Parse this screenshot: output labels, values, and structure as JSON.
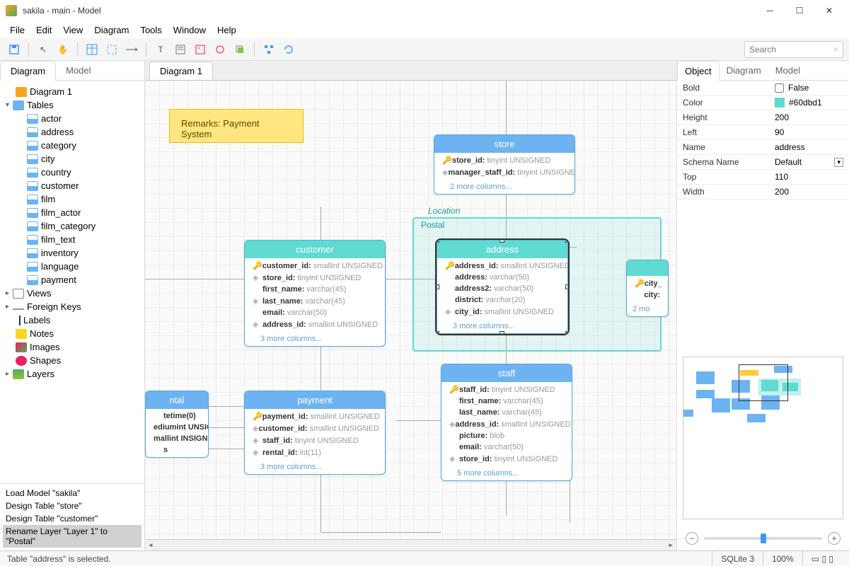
{
  "window": {
    "title": "sakila - main - Model"
  },
  "menu": [
    "File",
    "Edit",
    "View",
    "Diagram",
    "Tools",
    "Window",
    "Help"
  ],
  "search": {
    "placeholder": "Search"
  },
  "left": {
    "tabs": [
      "Diagram",
      "Model"
    ],
    "tree": {
      "diagram": "Diagram 1",
      "tables_label": "Tables",
      "tables": [
        "actor",
        "address",
        "category",
        "city",
        "country",
        "customer",
        "film",
        "film_actor",
        "film_category",
        "film_text",
        "inventory",
        "language",
        "payment"
      ],
      "views": "Views",
      "fkeys": "Foreign Keys",
      "labels": "Labels",
      "notes": "Notes",
      "images": "Images",
      "shapes": "Shapes",
      "layers": "Layers"
    },
    "history": [
      "Load Model \"sakila\"",
      "Design Table \"store\"",
      "Design Table \"customer\"",
      "Rename Layer \"Layer 1\" to \"Postal\""
    ]
  },
  "canvas": {
    "tab": "Diagram 1",
    "note": "Remarks: Payment System",
    "location_label": "Location",
    "postal_label": "Postal",
    "entities": {
      "store": {
        "title": "store",
        "rows": [
          [
            "pk",
            "store_id:",
            "tinyint UNSIGNED"
          ],
          [
            "fk",
            "manager_staff_id:",
            "tinyint UNSIGNED"
          ]
        ],
        "more": "2 more columns..."
      },
      "customer": {
        "title": "customer",
        "rows": [
          [
            "pk",
            "customer_id:",
            "smallint UNSIGNED"
          ],
          [
            "fk",
            "store_id:",
            "tinyint UNSIGNED"
          ],
          [
            "",
            "first_name:",
            "varchar(45)"
          ],
          [
            "fk",
            "last_name:",
            "varchar(45)"
          ],
          [
            "",
            "email:",
            "varchar(50)"
          ],
          [
            "fk",
            "address_id:",
            "smallint UNSIGNED"
          ]
        ],
        "more": "3 more columns..."
      },
      "address": {
        "title": "address",
        "rows": [
          [
            "pk",
            "address_id:",
            "smallint UNSIGNED"
          ],
          [
            "",
            "address:",
            "varchar(50)"
          ],
          [
            "",
            "address2:",
            "varchar(50)"
          ],
          [
            "",
            "district:",
            "varchar(20)"
          ],
          [
            "fk",
            "city_id:",
            "smallint UNSIGNED"
          ]
        ],
        "more": "3 more columns..."
      },
      "city": {
        "title": "",
        "rows": [
          [
            "pk",
            "city_",
            ""
          ],
          [
            "",
            "city:",
            ""
          ]
        ],
        "more": "2 mo"
      },
      "rental": {
        "title": "ntal",
        "rows": [
          [
            "",
            "tetime(0)",
            ""
          ],
          [
            "",
            "ediumint UNSIGN...",
            ""
          ],
          [
            "",
            "mallint INSIGNED",
            ""
          ],
          [
            "",
            "s",
            ""
          ]
        ]
      },
      "payment": {
        "title": "payment",
        "rows": [
          [
            "pk",
            "payment_id:",
            "smallint UNSIGNED"
          ],
          [
            "fk",
            "customer_id:",
            "smallint UNSIGNED"
          ],
          [
            "fk",
            "staff_id:",
            "tinyint UNSIGNED"
          ],
          [
            "fk",
            "rental_id:",
            "int(11)"
          ]
        ],
        "more": "3 more columns..."
      },
      "staff": {
        "title": "staff",
        "rows": [
          [
            "pk",
            "staff_id:",
            "tinyint UNSIGNED"
          ],
          [
            "",
            "first_name:",
            "varchar(45)"
          ],
          [
            "",
            "last_name:",
            "varchar(45)"
          ],
          [
            "fk",
            "address_id:",
            "smallint UNSIGNED"
          ],
          [
            "",
            "picture:",
            "blob"
          ],
          [
            "",
            "email:",
            "varchar(50)"
          ],
          [
            "fk",
            "store_id:",
            "tinyint UNSIGNED"
          ]
        ],
        "more": "5 more columns..."
      }
    }
  },
  "right": {
    "tabs": [
      "Object",
      "Diagram",
      "Model"
    ],
    "props": [
      [
        "Bold",
        "False"
      ],
      [
        "Color",
        "#60dbd1"
      ],
      [
        "Height",
        "200"
      ],
      [
        "Left",
        "90"
      ],
      [
        "Name",
        "address"
      ],
      [
        "Schema Name",
        "Default"
      ],
      [
        "Top",
        "110"
      ],
      [
        "Width",
        "200"
      ]
    ]
  },
  "status": {
    "msg": "Table \"address\" is selected.",
    "engine": "SQLite 3",
    "zoom": "100%"
  }
}
